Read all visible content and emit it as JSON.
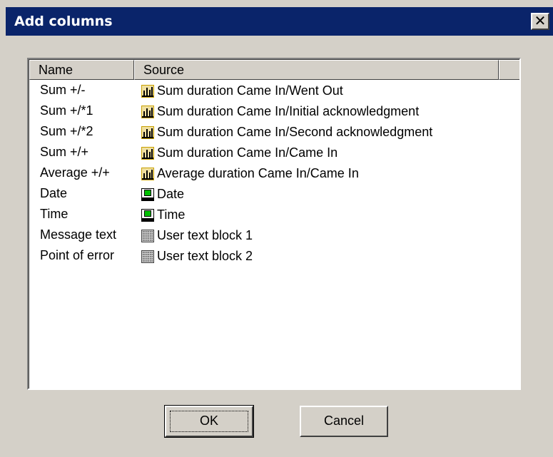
{
  "window": {
    "title": "Add columns",
    "close_glyph": "✕"
  },
  "list": {
    "columns": [
      "Name",
      "Source"
    ],
    "rows": [
      {
        "name": "Sum +/-",
        "source": "Sum duration Came In/Went Out",
        "icon": "statistics-icon"
      },
      {
        "name": "Sum +/*1",
        "source": "Sum duration Came In/Initial acknowledgment",
        "icon": "statistics-icon"
      },
      {
        "name": "Sum +/*2",
        "source": "Sum duration Came In/Second acknowledgment",
        "icon": "statistics-icon"
      },
      {
        "name": "Sum +/+",
        "source": "Sum duration Came In/Came In",
        "icon": "statistics-icon"
      },
      {
        "name": "Average +/+",
        "source": "Average duration Came In/Came In",
        "icon": "statistics-icon"
      },
      {
        "name": "Date",
        "source": "Date",
        "icon": "system-block-icon"
      },
      {
        "name": "Time",
        "source": "Time",
        "icon": "system-block-icon"
      },
      {
        "name": "Message text",
        "source": "User text block 1",
        "icon": "text-block-icon"
      },
      {
        "name": "Point of error",
        "source": "User text block 2",
        "icon": "text-block-icon"
      }
    ]
  },
  "buttons": {
    "ok_label": "OK",
    "cancel_label": "Cancel"
  },
  "colors": {
    "titlebar": "#0a246a",
    "face": "#d4d0c8",
    "icon_green": "#00a000",
    "icon_gold": "#c8a000"
  }
}
